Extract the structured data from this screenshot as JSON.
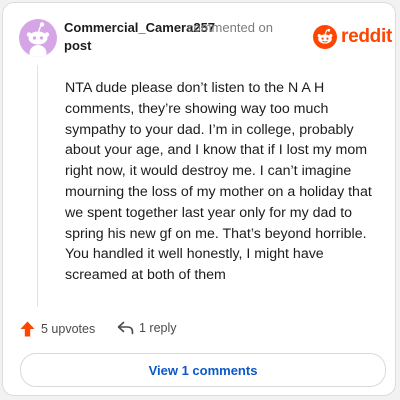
{
  "comment": {
    "username": "Commercial_Camera257",
    "action": "commented on",
    "target": "post",
    "body": "NTA dude please don’t listen to the N A H comments, they’re showing way too much sympathy to your dad. I’m in college, probably about your age, and I know that if I lost my mom right now, it would destroy me. I can’t imagine mourning the loss of my mother on a holiday that we spent together last year only for my dad to spring his new gf on me. That’s beyond horrible. You handled it well honestly, I might have screamed at both of them",
    "upvotes": "5 upvotes",
    "replies": "1 reply",
    "view_comments": "View 1 comments"
  },
  "brand": {
    "name": "reddit",
    "color": "#ff4500"
  },
  "icons": {
    "avatar": "snoo-avatar",
    "logo": "reddit-snoo-icon",
    "upvote": "upvote-arrow-icon",
    "reply": "reply-arrow-icon"
  },
  "colors": {
    "avatar_bg": "#d6a5e6",
    "link_blue": "#0a59c7"
  }
}
